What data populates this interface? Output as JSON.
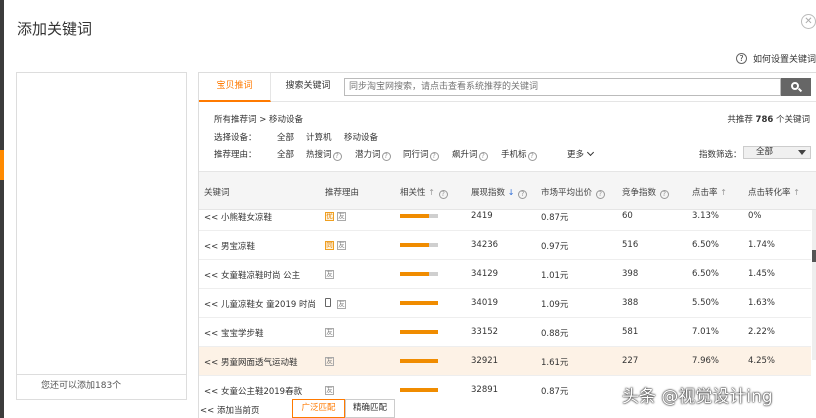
{
  "dialog": {
    "title": "添加关键词",
    "help_label": "如何设置关键词"
  },
  "left": {
    "count_text": "您还可以添加183个"
  },
  "tabs": [
    {
      "label": "宝贝推词"
    },
    {
      "label": "搜索关键词"
    }
  ],
  "search": {
    "placeholder": "同步淘宝网搜索，请点击查看系统推荐的关键词"
  },
  "filters": {
    "breadcrumb": "所有推荐词 >  移动设备",
    "total_prefix": "共推荐",
    "total_count": "786",
    "total_suffix": "个关键词",
    "device_label": "选择设备：",
    "devices": [
      "全部",
      "计算机",
      "移动设备"
    ],
    "reason_label": "推荐理由：",
    "reasons": [
      "全部",
      "热搜词",
      "潜力词",
      "同行词",
      "飙升词",
      "手机标"
    ],
    "more_label": "更多",
    "index_filter_label": "指数筛选：",
    "index_filter_value": "全部"
  },
  "table": {
    "headers": [
      "关键词",
      "推荐理由",
      "相关性",
      "展现指数",
      "市场平均出价",
      "竞争指数",
      "点击率",
      "点击转化率"
    ],
    "rows": [
      {
        "keyword": "<< 小熊鞋女凉鞋",
        "badges": [
          "优",
          "友"
        ],
        "relevance": 0.75,
        "impressions": "2419",
        "bid": "0.87元",
        "competition": "60",
        "ctr": "3.13%",
        "cvr": "0%"
      },
      {
        "keyword": "<< 男宝凉鞋",
        "badges": [
          "同",
          "友"
        ],
        "relevance": 0.75,
        "impressions": "34236",
        "bid": "0.97元",
        "competition": "516",
        "ctr": "6.50%",
        "cvr": "1.74%"
      },
      {
        "keyword": "<< 女童鞋凉鞋时尚 公主",
        "badges": [
          "友"
        ],
        "relevance": 0.75,
        "impressions": "34129",
        "bid": "1.01元",
        "competition": "398",
        "ctr": "6.50%",
        "cvr": "1.45%"
      },
      {
        "keyword": "<< 儿童凉鞋女 童2019 时尚",
        "badges": [
          "phone",
          "友"
        ],
        "relevance": 1.0,
        "impressions": "34019",
        "bid": "1.09元",
        "competition": "388",
        "ctr": "5.50%",
        "cvr": "1.63%"
      },
      {
        "keyword": "<< 宝宝学步鞋",
        "badges": [
          "友"
        ],
        "relevance": 1.0,
        "impressions": "33152",
        "bid": "0.88元",
        "competition": "581",
        "ctr": "7.01%",
        "cvr": "2.22%"
      },
      {
        "keyword": "<< 男童网面透气运动鞋",
        "badges": [
          "友"
        ],
        "relevance": 1.0,
        "impressions": "32921",
        "bid": "1.61元",
        "competition": "227",
        "ctr": "7.96%",
        "cvr": "4.25%"
      },
      {
        "keyword": "<< 女童公主鞋2019春款",
        "badges": [
          "友"
        ],
        "relevance": 1.0,
        "impressions": "32891",
        "bid": "0.87元",
        "competition": "",
        "ctr": "",
        "cvr": ""
      }
    ]
  },
  "footer": {
    "add_page_label": "<< 添加当前页",
    "match_broad": "广泛匹配",
    "match_exact": "精确匹配"
  },
  "watermark": "头条 @视觉设计ing",
  "colors": {
    "accent": "#ff7a00",
    "bar_fill": "#f08c00",
    "sort_active": "#2a6bd6"
  }
}
